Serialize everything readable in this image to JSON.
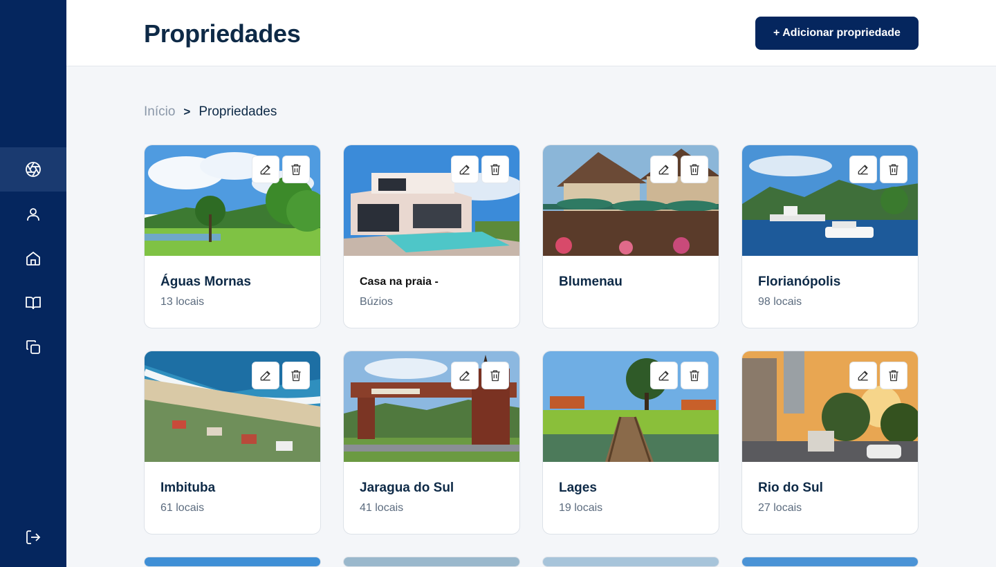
{
  "header": {
    "title": "Propriedades",
    "add_button": "+ Adicionar propriedade"
  },
  "breadcrumb": {
    "home": "Início",
    "separator": ">",
    "current": "Propriedades"
  },
  "sidebar": {
    "items": [
      {
        "icon": "aperture-icon",
        "active": true
      },
      {
        "icon": "user-icon",
        "active": false
      },
      {
        "icon": "home-icon",
        "active": false
      },
      {
        "icon": "book-icon",
        "active": false
      },
      {
        "icon": "copy-icon",
        "active": false
      }
    ],
    "logout_icon": "logout-icon"
  },
  "properties": [
    {
      "name": "Águas Mornas",
      "subtitle": "13 locais",
      "image": "park-lake"
    },
    {
      "name": "Casa na praia  -",
      "subtitle": "Búzios",
      "image": "modern-house-pool"
    },
    {
      "name": "Blumenau",
      "subtitle": "",
      "image": "german-village"
    },
    {
      "name": "Florianópolis",
      "subtitle": "98 locais",
      "image": "bay-boats"
    },
    {
      "name": "Imbituba",
      "subtitle": "61 locais",
      "image": "beach-aerial"
    },
    {
      "name": "Jaragua do Sul",
      "subtitle": "41 locais",
      "image": "city-gate"
    },
    {
      "name": "Lages",
      "subtitle": "19 locais",
      "image": "lake-bridge"
    },
    {
      "name": "Rio do Sul",
      "subtitle": "27 locais",
      "image": "city-street"
    }
  ],
  "colors": {
    "sidebar": "#05265e",
    "primary": "#05265e",
    "text": "#0e2a47",
    "muted": "#5b6b7e",
    "background": "#f4f6f9"
  }
}
